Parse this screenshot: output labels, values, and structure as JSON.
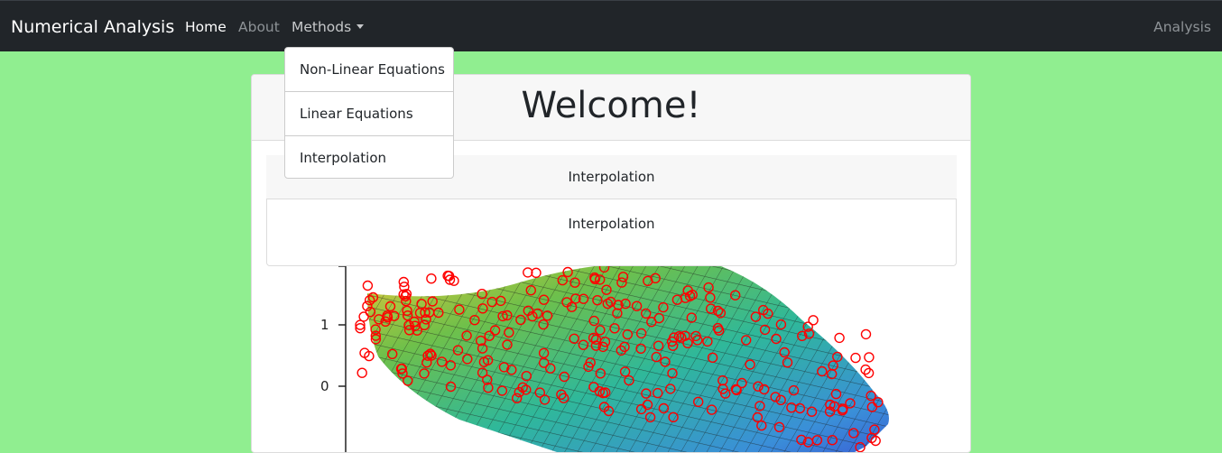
{
  "navbar": {
    "brand": "Numerical Analysis",
    "items": [
      {
        "label": "Home"
      },
      {
        "label": "About"
      },
      {
        "label": "Methods"
      }
    ],
    "right_link": "Analysis"
  },
  "methods_dropdown": {
    "items": [
      {
        "label": "Non-Linear Equations"
      },
      {
        "label": "Linear Equations"
      },
      {
        "label": "Interpolation"
      }
    ]
  },
  "card": {
    "title": "Welcome!",
    "section_header": "Interpolation",
    "section_body": "Interpolation"
  },
  "figure": {
    "y_tick_labels": [
      "1",
      "0"
    ],
    "description": "3D surface plot with red circle markers"
  },
  "colors": {
    "navbar_bg": "#212529",
    "page_bg": "#90ee90",
    "marker": "#ff0000"
  }
}
